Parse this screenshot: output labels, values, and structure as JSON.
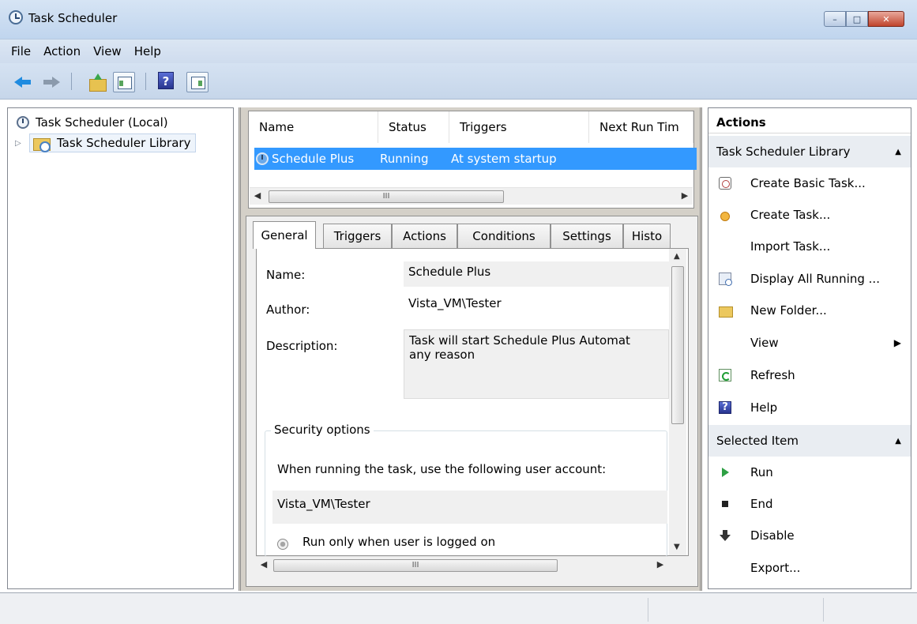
{
  "window": {
    "title": "Task Scheduler",
    "icon": "clock-icon"
  },
  "menu": {
    "items": [
      "File",
      "Action",
      "View",
      "Help"
    ]
  },
  "tree": {
    "root_label": "Task Scheduler (Local)",
    "library_label": "Task Scheduler Library"
  },
  "task_list": {
    "columns": [
      "Name",
      "Status",
      "Triggers",
      "Next Run Tim"
    ],
    "rows": [
      {
        "name": "Schedule Plus",
        "status": "Running",
        "trigger": "At system startup",
        "next_run": ""
      }
    ],
    "scroll_grip": "III"
  },
  "details": {
    "tabs": [
      "General",
      "Triggers",
      "Actions",
      "Conditions",
      "Settings",
      "Histo"
    ],
    "active_tab": "General",
    "name_label": "Name:",
    "name_value": "Schedule Plus",
    "author_label": "Author:",
    "author_value": "Vista_VM\\Tester",
    "description_label": "Description:",
    "description_line1": "Task will start Schedule Plus Automat",
    "description_line2": "any reason",
    "security_title": "Security options",
    "security_prompt": "When running the task, use the following user account:",
    "security_account": "Vista_VM\\Tester",
    "radio_label": "Run only when user is logged on",
    "scroll_grip": "III"
  },
  "actions_pane": {
    "header": "Actions",
    "section1": "Task Scheduler Library",
    "items1": [
      {
        "label": "Create Basic Task...",
        "icon": "create-basic-task-icon"
      },
      {
        "label": "Create Task...",
        "icon": "create-task-icon"
      },
      {
        "label": "Import Task...",
        "icon": ""
      },
      {
        "label": "Display All Running ...",
        "icon": "display-running-icon"
      },
      {
        "label": "New Folder...",
        "icon": "new-folder-icon"
      },
      {
        "label": "View",
        "icon": ""
      },
      {
        "label": "Refresh",
        "icon": "refresh-icon"
      },
      {
        "label": "Help",
        "icon": "help-icon"
      }
    ],
    "section2": "Selected Item",
    "items2": [
      {
        "label": "Run",
        "icon": "run-icon"
      },
      {
        "label": "End",
        "icon": "end-icon"
      },
      {
        "label": "Disable",
        "icon": "disable-icon"
      },
      {
        "label": "Export...",
        "icon": ""
      }
    ]
  },
  "colors": {
    "selection": "#3399ff",
    "titlebar": "#c9dbf0",
    "section_bg": "#e9edf2"
  }
}
